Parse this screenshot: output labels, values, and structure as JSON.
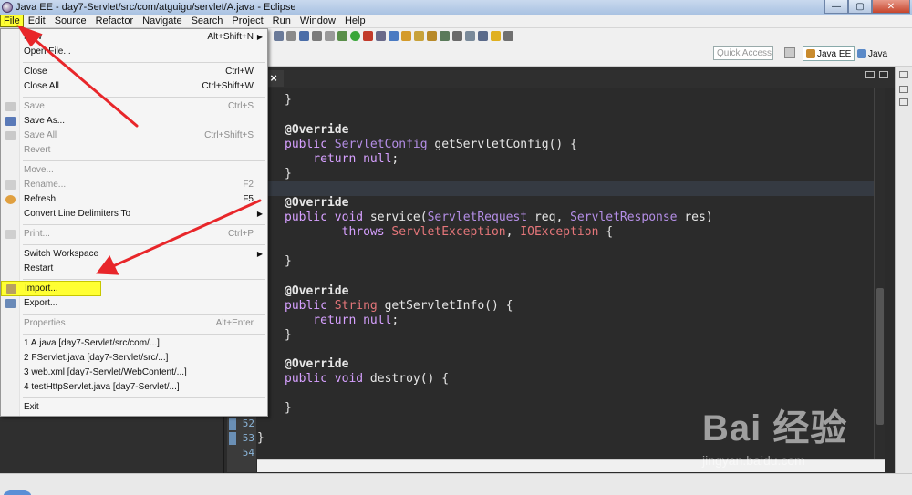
{
  "window": {
    "title": "Java EE - day7-Servlet/src/com/atguigu/servlet/A.java - Eclipse",
    "minimize": "—",
    "maximize": "▢",
    "close": "✕"
  },
  "menubar": [
    "File",
    "Edit",
    "Source",
    "Refactor",
    "Navigate",
    "Search",
    "Project",
    "Run",
    "Window",
    "Help"
  ],
  "toolbar": {
    "quick_access_placeholder": "Quick Access",
    "perspectives": [
      "Java EE",
      "Java"
    ]
  },
  "editor": {
    "tab_close": "×",
    "line_numbers": [
      "52",
      "53",
      "54"
    ],
    "code": {
      "l1": "}",
      "l2": "@Override",
      "l3a": "public ",
      "l3b": "ServletConfig",
      "l3c": " getServletConfig() {",
      "l4a": "    return ",
      "l4b": "null",
      "l4c": ";",
      "l5": "}",
      "l6": "@Override",
      "l7a": "public ",
      "l7b": "void",
      "l7c": " service(",
      "l7d": "ServletRequest",
      "l7e": " req, ",
      "l7f": "ServletResponse",
      "l7g": " res)",
      "l8a": "        throws ",
      "l8b": "ServletException",
      "l8c": ", ",
      "l8d": "IOException",
      "l8e": " {",
      "l9": "}",
      "l10": "@Override",
      "l11a": "public ",
      "l11b": "String",
      "l11c": " getServletInfo() {",
      "l12a": "    return ",
      "l12b": "null",
      "l12c": ";",
      "l13": "}",
      "l14": "@Override",
      "l15a": "public ",
      "l15b": "void",
      "l15c": " destroy() {",
      "l16": "}",
      "l17": "}"
    }
  },
  "file_menu": {
    "new": {
      "label": "New",
      "shortcut": "Alt+Shift+N"
    },
    "open_file": {
      "label": "Open File..."
    },
    "close": {
      "label": "Close",
      "shortcut": "Ctrl+W"
    },
    "close_all": {
      "label": "Close All",
      "shortcut": "Ctrl+Shift+W"
    },
    "save": {
      "label": "Save",
      "shortcut": "Ctrl+S"
    },
    "save_as": {
      "label": "Save As..."
    },
    "save_all": {
      "label": "Save All",
      "shortcut": "Ctrl+Shift+S"
    },
    "revert": {
      "label": "Revert"
    },
    "move": {
      "label": "Move..."
    },
    "rename": {
      "label": "Rename...",
      "shortcut": "F2"
    },
    "refresh": {
      "label": "Refresh",
      "shortcut": "F5"
    },
    "convert": {
      "label": "Convert Line Delimiters To"
    },
    "print": {
      "label": "Print...",
      "shortcut": "Ctrl+P"
    },
    "switch_workspace": {
      "label": "Switch Workspace"
    },
    "restart": {
      "label": "Restart"
    },
    "import": {
      "label": "Import..."
    },
    "export": {
      "label": "Export..."
    },
    "properties": {
      "label": "Properties",
      "shortcut": "Alt+Enter"
    },
    "recent": [
      "1 A.java  [day7-Servlet/src/com/...]",
      "2 FServlet.java  [day7-Servlet/src/...]",
      "3 web.xml  [day7-Servlet/WebContent/...]",
      "4 testHttpServlet.java  [day7-Servlet/...]"
    ],
    "exit": {
      "label": "Exit"
    }
  },
  "watermark": {
    "brand": "Bai 经验",
    "url": "jingyan.baidu.com"
  },
  "colors": {
    "highlight": "#ffff33",
    "arrow": "#e8262a",
    "editor_bg": "#2b2b2b"
  }
}
